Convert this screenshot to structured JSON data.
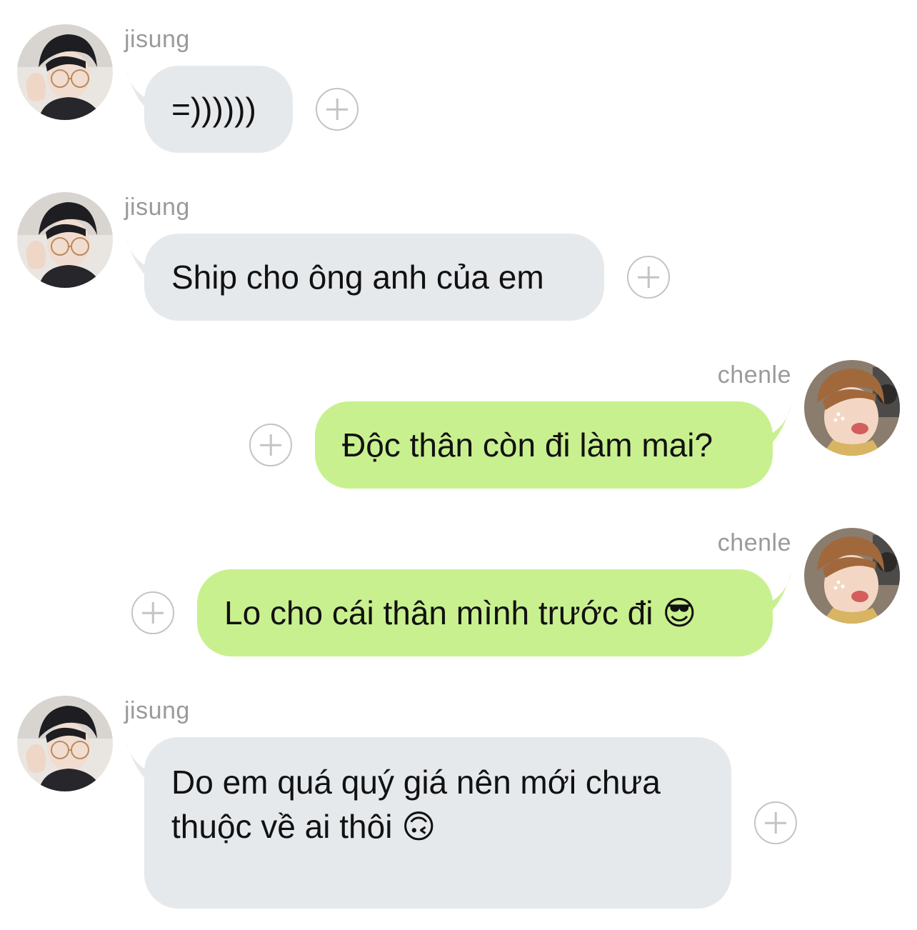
{
  "colors": {
    "incoming_bubble": "#e6e9ec",
    "outgoing_bubble": "#c9f08f",
    "sender_name": "#9a9a9a",
    "add_reaction_icon": "#c4c4c4"
  },
  "messages": [
    {
      "sender": "jisung",
      "direction": "incoming",
      "text": "=))))))",
      "reaction_icon": "plus-circle-icon"
    },
    {
      "sender": "jisung",
      "direction": "incoming",
      "text": "Ship cho ông anh của em",
      "reaction_icon": "plus-circle-icon"
    },
    {
      "sender": "chenle",
      "direction": "outgoing",
      "text": "Độc thân còn đi làm mai?",
      "reaction_icon": "plus-circle-icon"
    },
    {
      "sender": "chenle",
      "direction": "outgoing",
      "text": "Lo cho cái thân mình trước đi 😎",
      "reaction_icon": "plus-circle-icon"
    },
    {
      "sender": "jisung",
      "direction": "incoming",
      "text": "Do em quá quý giá nên mới chưa\nthuộc về ai thôi 🙃",
      "reaction_icon": "plus-circle-icon"
    }
  ]
}
